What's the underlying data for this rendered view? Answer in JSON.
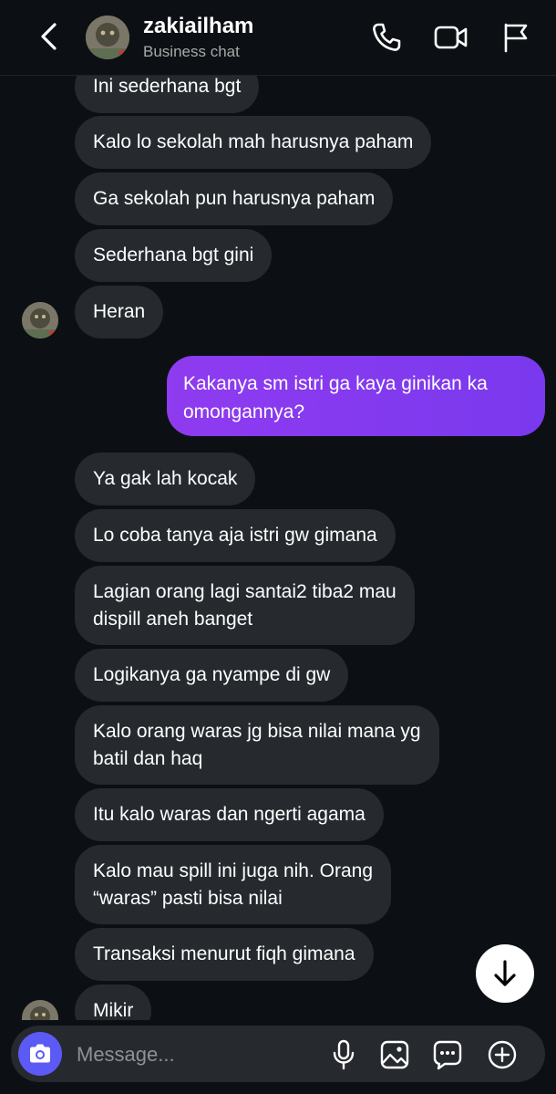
{
  "header": {
    "username": "zakiailham",
    "subtitle": "Business chat",
    "icons": [
      "back-chevron-icon",
      "phone-icon",
      "video-camera-icon",
      "flag-icon"
    ]
  },
  "messages": [
    {
      "direction": "in",
      "text": "Ini sederhana bgt"
    },
    {
      "direction": "in",
      "text": "Kalo lo sekolah mah harusnya paham"
    },
    {
      "direction": "in",
      "text": "Ga sekolah pun harusnya paham"
    },
    {
      "direction": "in",
      "text": "Sederhana bgt gini"
    },
    {
      "direction": "in",
      "text": "Heran"
    },
    {
      "direction": "out",
      "text": "Kakanya sm istri ga kaya ginikan ka omongannya?"
    },
    {
      "direction": "in",
      "text": "Ya gak lah kocak"
    },
    {
      "direction": "in",
      "text": "Lo coba tanya aja istri gw gimana"
    },
    {
      "direction": "in",
      "lines": [
        "Lagian orang lagi santai2 tiba2 mau",
        "dispill aneh banget"
      ]
    },
    {
      "direction": "in",
      "text": "Logikanya ga nyampe di gw"
    },
    {
      "direction": "in",
      "lines": [
        "Kalo orang waras jg bisa nilai mana yg",
        "batil dan haq"
      ]
    },
    {
      "direction": "in",
      "text": "Itu kalo waras dan ngerti agama"
    },
    {
      "direction": "in",
      "lines": [
        "Kalo mau spill ini juga nih. Orang",
        "“waras” pasti bisa nilai"
      ]
    },
    {
      "direction": "in",
      "text": "Transaksi menurut fiqh gimana"
    },
    {
      "direction": "in",
      "text": "Mikir"
    }
  ],
  "composer": {
    "placeholder": "Message...",
    "icons": [
      "camera-icon",
      "microphone-icon",
      "gallery-icon",
      "sticker-icon",
      "add-icon"
    ]
  },
  "scroll_button": {
    "icon": "arrow-down-icon"
  },
  "colors": {
    "background": "#0c1014",
    "incoming_bubble": "#262a2f",
    "outgoing_bubble_start": "#8f3bf0",
    "outgoing_bubble_end": "#7a39ee",
    "camera_button": "#5b5af5"
  }
}
